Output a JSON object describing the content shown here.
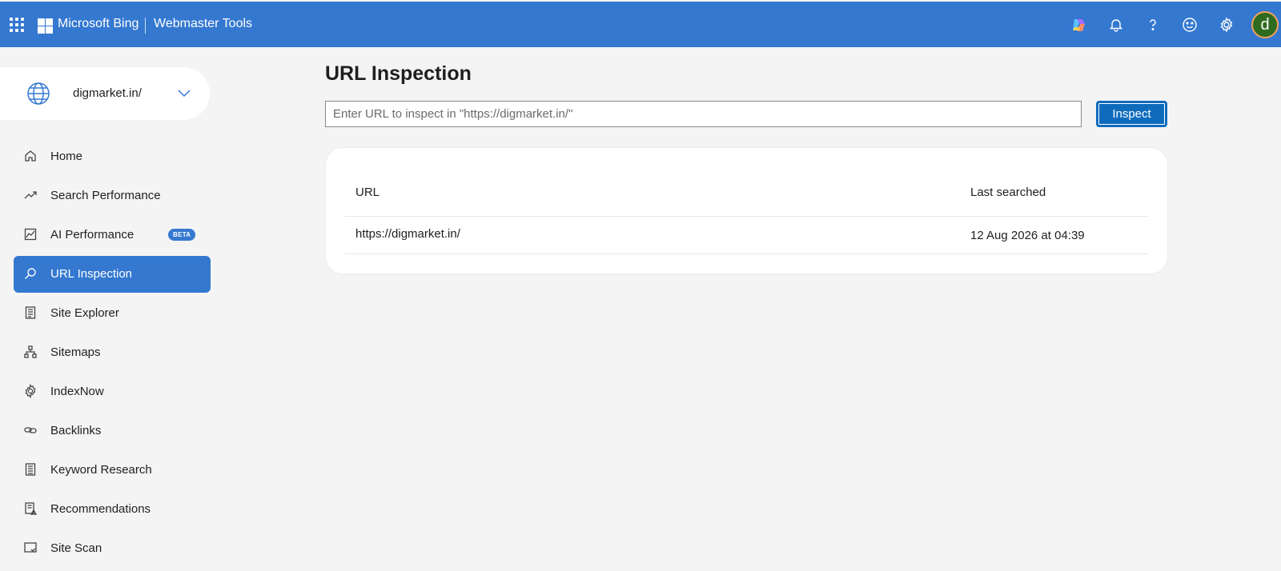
{
  "header": {
    "brand": "Microsoft Bing",
    "product": "Webmaster Tools",
    "avatar_initial": "d",
    "icons": [
      "waffle-icon",
      "copilot-icon",
      "bell-icon",
      "help-icon",
      "feedback-icon",
      "settings-icon"
    ]
  },
  "site": {
    "name": "digmarket.in/"
  },
  "sidebar": {
    "items": [
      {
        "label": "Home",
        "icon": "home-icon"
      },
      {
        "label": "Search Performance",
        "icon": "trend-icon"
      },
      {
        "label": "AI Performance",
        "icon": "chart-icon",
        "badge": "BETA"
      },
      {
        "label": "URL Inspection",
        "icon": "search-icon",
        "active": true
      },
      {
        "label": "Site Explorer",
        "icon": "document-icon"
      },
      {
        "label": "Sitemaps",
        "icon": "sitemap-icon"
      },
      {
        "label": "IndexNow",
        "icon": "gear-icon"
      },
      {
        "label": "Backlinks",
        "icon": "link-icon"
      },
      {
        "label": "Keyword Research",
        "icon": "document-list-icon"
      },
      {
        "label": "Recommendations",
        "icon": "checklist-icon"
      },
      {
        "label": "Site Scan",
        "icon": "scan-icon"
      }
    ]
  },
  "main": {
    "title": "URL Inspection",
    "search": {
      "placeholder": "Enter URL to inspect in \"https://digmarket.in/\"",
      "value": ""
    },
    "inspect_label": "Inspect",
    "table": {
      "columns": [
        "URL",
        "Last searched"
      ],
      "rows": [
        {
          "url": "https://digmarket.in/",
          "last_searched": "12 Aug 2026 at 04:39"
        }
      ]
    }
  },
  "colors": {
    "accent": "#3478d0",
    "button": "#0f6cbd",
    "background": "#f4f4f4"
  }
}
